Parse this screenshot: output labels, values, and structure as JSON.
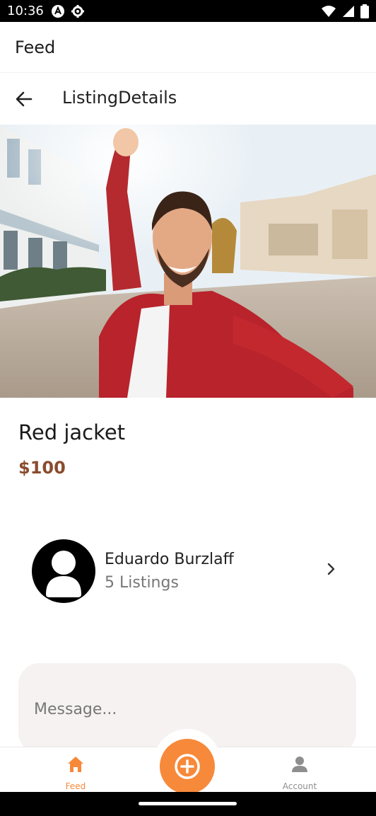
{
  "status_bar": {
    "time": "10:36",
    "icons": [
      "app-a-icon",
      "settings-gear-icon",
      "wifi-icon",
      "signal-icon",
      "battery-icon"
    ]
  },
  "header": {
    "title": "Feed"
  },
  "navigation": {
    "title": "ListingDetails",
    "back_icon": "arrow-left-icon"
  },
  "listing": {
    "title": "Red jacket",
    "price": "$100",
    "price_color": "#8a4b2e"
  },
  "seller": {
    "name": "Eduardo Burzlaff",
    "listings": "5 Listings",
    "avatar_icon": "person-avatar-icon"
  },
  "message": {
    "placeholder": "Message..."
  },
  "tabs": [
    {
      "label": "Feed",
      "icon": "home-icon",
      "active": true
    },
    {
      "label": "Account",
      "icon": "person-icon",
      "active": false
    }
  ],
  "colors": {
    "accent": "#f7893a",
    "inactive": "#8e8e8e"
  }
}
